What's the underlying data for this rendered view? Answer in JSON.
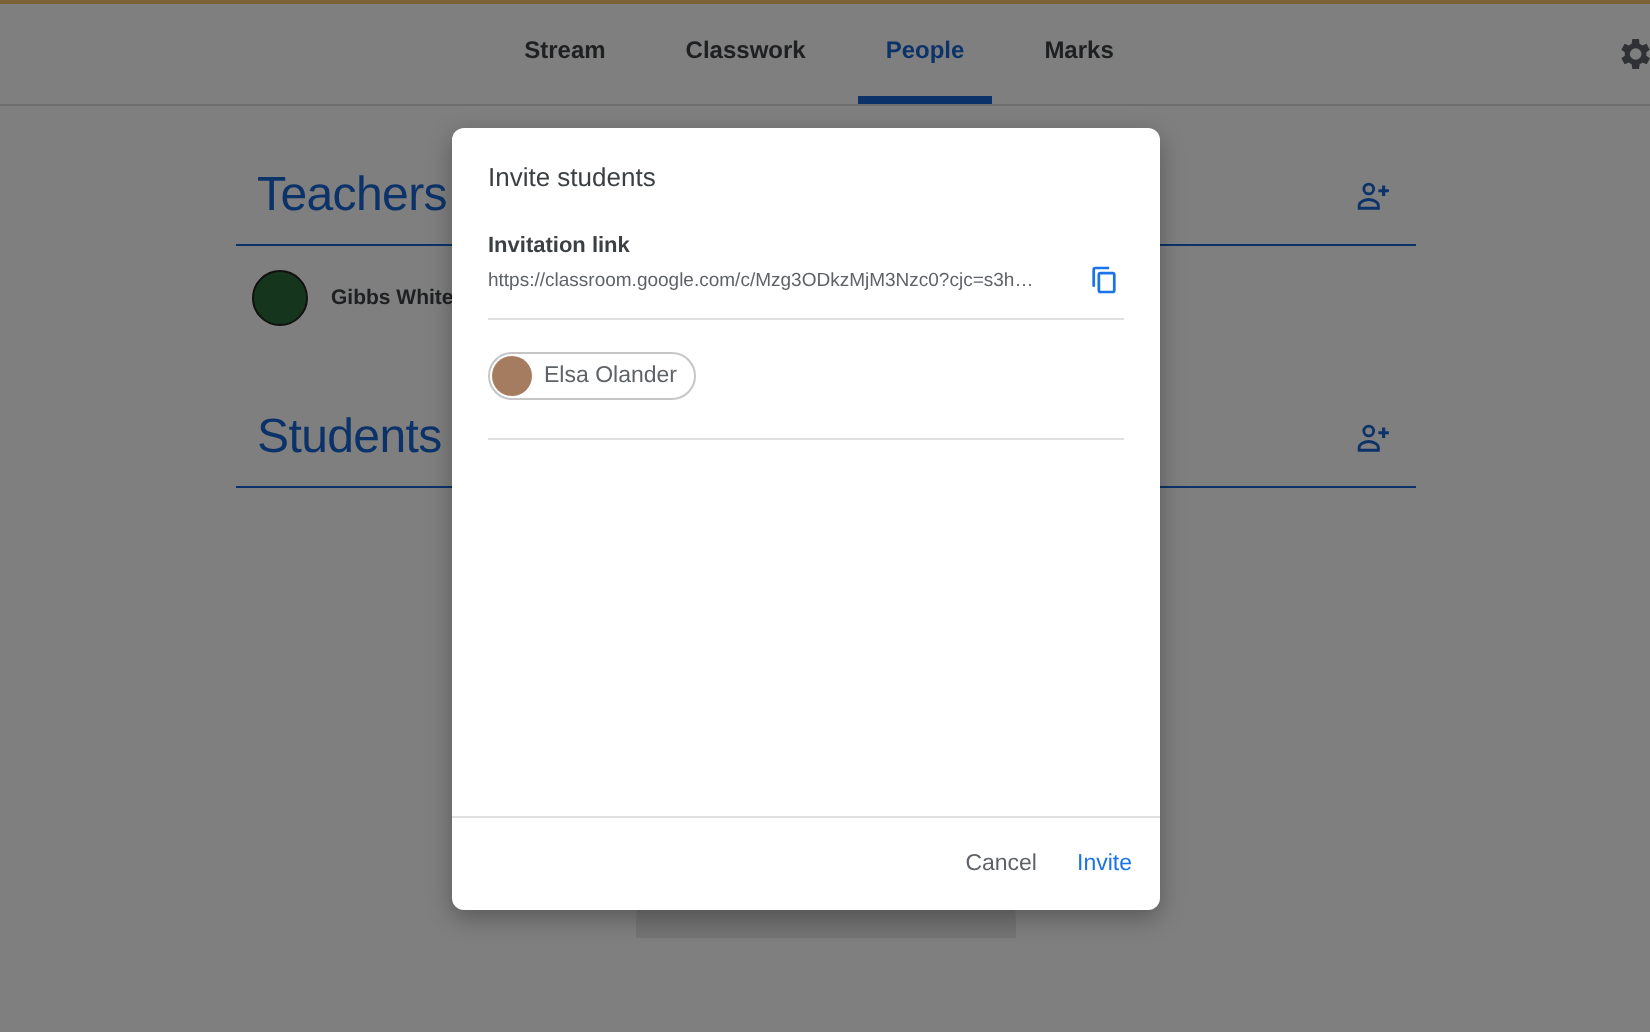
{
  "tabs": [
    {
      "label": "Stream",
      "selected": false
    },
    {
      "label": "Classwork",
      "selected": false
    },
    {
      "label": "People",
      "selected": true
    },
    {
      "label": "Marks",
      "selected": false
    }
  ],
  "sections": [
    {
      "title": "Teachers",
      "people": [
        {
          "name": "Gibbs White"
        }
      ]
    },
    {
      "title": "Students"
    }
  ],
  "dialog": {
    "title": "Invite students",
    "link_label": "Invitation link",
    "link": "https://classroom.google.com/c/Mzg3ODkzMjM3Nzc0?cjc=s3h…",
    "chips": [
      {
        "name": "Elsa Olander"
      }
    ],
    "buttons": [
      {
        "label": "Cancel",
        "kind": "secondary"
      },
      {
        "label": "Invite",
        "kind": "primary"
      }
    ]
  }
}
